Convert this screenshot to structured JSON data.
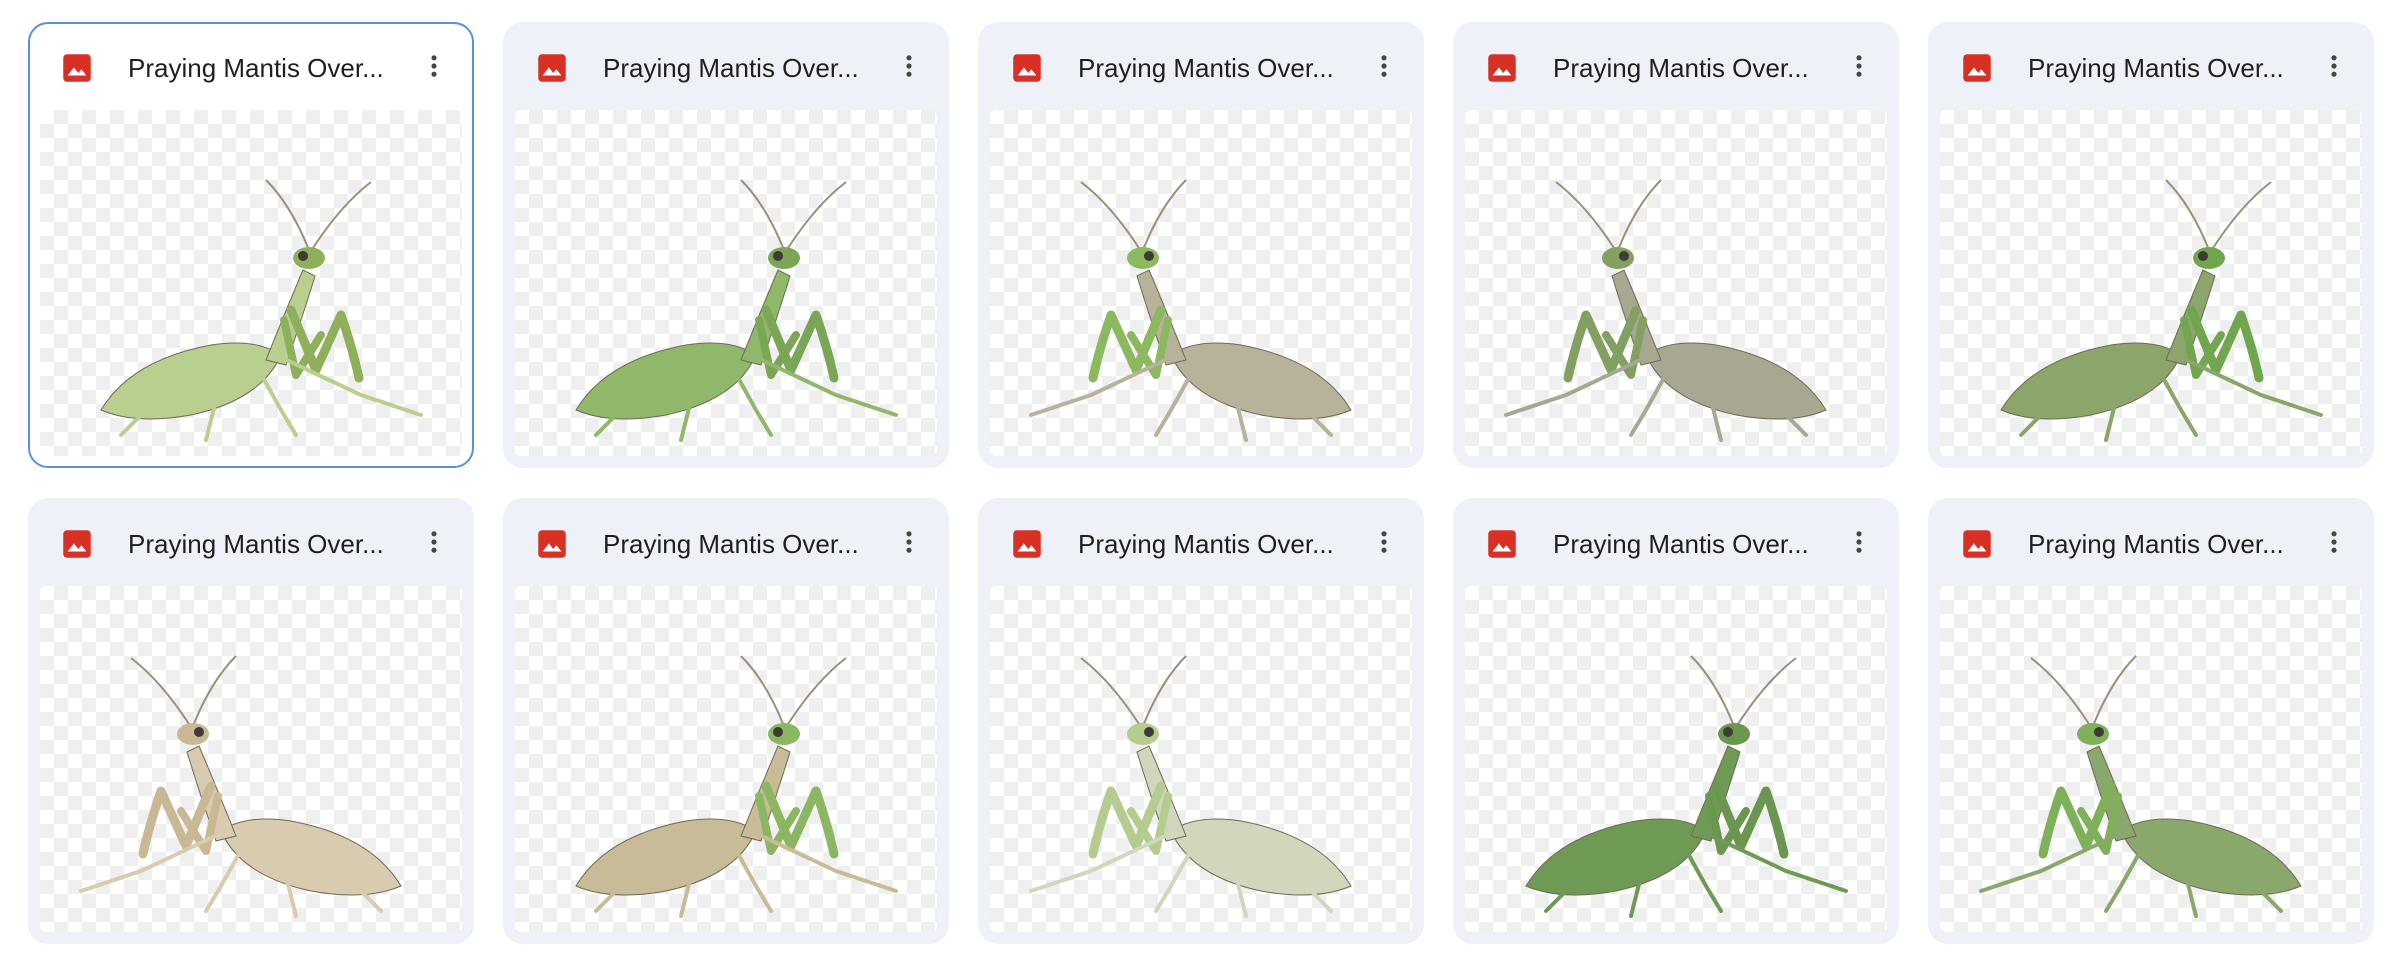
{
  "files": [
    {
      "title": "Praying Mantis Over...",
      "selected": true,
      "body": "#b9cf90",
      "limb": "#8fb05a",
      "facing": "right"
    },
    {
      "title": "Praying Mantis Over...",
      "selected": false,
      "body": "#8fb86a",
      "limb": "#7aa656",
      "facing": "right"
    },
    {
      "title": "Praying Mantis Over...",
      "selected": false,
      "body": "#b8b29a",
      "limb": "#8cb860",
      "facing": "left"
    },
    {
      "title": "Praying Mantis Over...",
      "selected": false,
      "body": "#a8a792",
      "limb": "#82a062",
      "facing": "left"
    },
    {
      "title": "Praying Mantis Over...",
      "selected": false,
      "body": "#8ba56b",
      "limb": "#6fa64e",
      "facing": "right"
    },
    {
      "title": "Praying Mantis Over...",
      "selected": false,
      "body": "#d8cbb0",
      "limb": "#c9b893",
      "facing": "left"
    },
    {
      "title": "Praying Mantis Over...",
      "selected": false,
      "body": "#c8bc98",
      "limb": "#8bb662",
      "facing": "right"
    },
    {
      "title": "Praying Mantis Over...",
      "selected": false,
      "body": "#d2d6bc",
      "limb": "#b4cd8e",
      "facing": "left"
    },
    {
      "title": "Praying Mantis Over...",
      "selected": false,
      "body": "#6f9a55",
      "limb": "#6a9650",
      "facing": "right"
    },
    {
      "title": "Praying Mantis Over...",
      "selected": false,
      "body": "#8aa86c",
      "limb": "#7fb05a",
      "facing": "left"
    }
  ],
  "icons": {
    "file_type": "image-icon",
    "more": "more-vert-icon"
  },
  "colors": {
    "file_icon": "#d93025",
    "selected_border": "#5b8fe0",
    "card_bg": "#eef2f8"
  }
}
